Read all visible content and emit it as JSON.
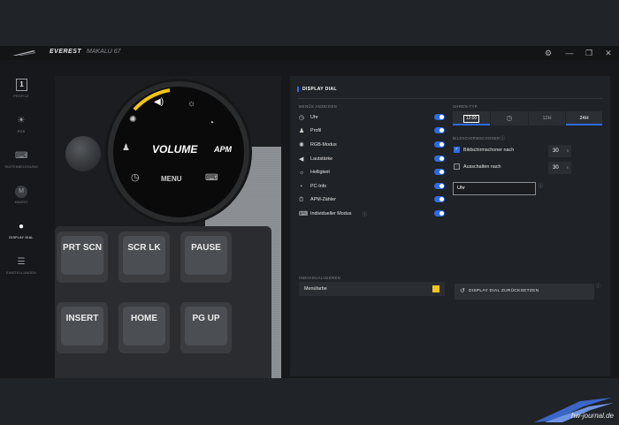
{
  "app": {
    "brand": "EVEREST",
    "model": "MAKALU 67"
  },
  "window_controls": {
    "settings": "⚙",
    "minimize": "—",
    "restore": "❐",
    "close": "✕"
  },
  "sidebar": {
    "items": [
      {
        "label": "PROFILE",
        "icon": "profile-number-icon",
        "glyph": "1"
      },
      {
        "label": "RGB",
        "icon": "sun-icon",
        "glyph": "☀"
      },
      {
        "label": "TASTENBELEGUNG",
        "icon": "keyboard-icon",
        "glyph": "⌨"
      },
      {
        "label": "MAKRO",
        "icon": "macro-icon",
        "glyph": "M"
      },
      {
        "label": "DISPLAY DIAL",
        "icon": "display-dial-icon",
        "glyph": "●"
      },
      {
        "label": "EINSTELLUNGEN",
        "icon": "sliders-icon",
        "glyph": "☰"
      }
    ],
    "active_index": 4
  },
  "preview": {
    "dial_main": "VOLUME",
    "dial_apm": "APM",
    "dial_menu": "MENU",
    "keys": [
      "PRT SCN",
      "SCR LK",
      "PAUSE",
      "INSERT",
      "HOME",
      "PG UP"
    ],
    "colors": {
      "accent_ring": "#f2c318"
    }
  },
  "content": {
    "section_title": "DISPLAY DIAL",
    "menu_header": "MENÜS ANZEIGEN",
    "menu_items": [
      {
        "label": "Uhr",
        "icon": "clock-icon",
        "glyph": "◷",
        "enabled": true
      },
      {
        "label": "Profil",
        "icon": "person-icon",
        "glyph": "♟",
        "enabled": true
      },
      {
        "label": "RGB-Modus",
        "icon": "rgb-sun-icon",
        "glyph": "✺",
        "enabled": true
      },
      {
        "label": "Lautstärke",
        "icon": "speaker-icon",
        "glyph": "◀",
        "enabled": true
      },
      {
        "label": "Helligkeit",
        "icon": "brightness-icon",
        "glyph": "☼",
        "enabled": true
      },
      {
        "label": "PC-Info",
        "icon": "gauge-icon",
        "glyph": "◔",
        "enabled": true
      },
      {
        "label": "APM-Zähler",
        "icon": "timer-icon",
        "glyph": "⏱",
        "enabled": true
      },
      {
        "label": "Individueller Modus",
        "icon": "custom-keyboard-icon",
        "glyph": "⌨",
        "enabled": true
      }
    ],
    "clock_type_header": "UHREN-TYP",
    "clock_types": [
      {
        "label": "12:00",
        "icon": "digital-clock-icon",
        "active": true
      },
      {
        "label": "◷",
        "icon": "analog-clock-icon",
        "active": false
      },
      {
        "label": "12H",
        "active": false
      },
      {
        "label": "24H",
        "active": true
      }
    ],
    "screensaver_header": "BILDSCHIRMSCHONER",
    "screensaver_after_label": "Bildschirmschoner nach",
    "screensaver_after_checked": true,
    "screensaver_after_value": "30",
    "switch_off_label": "Ausschalten nach",
    "switch_off_checked": false,
    "switch_off_value": "30",
    "unit": "s",
    "text_field_value": "Uhr",
    "individualize_header": "INDIVIDUALISIEREN",
    "menu_color_label": "Menüfarbe",
    "menu_color": "#f2c318",
    "reset_label": "DISPLAY DIAL ZURÜCKSETZEN"
  },
  "watermark": "hw-journal.de"
}
